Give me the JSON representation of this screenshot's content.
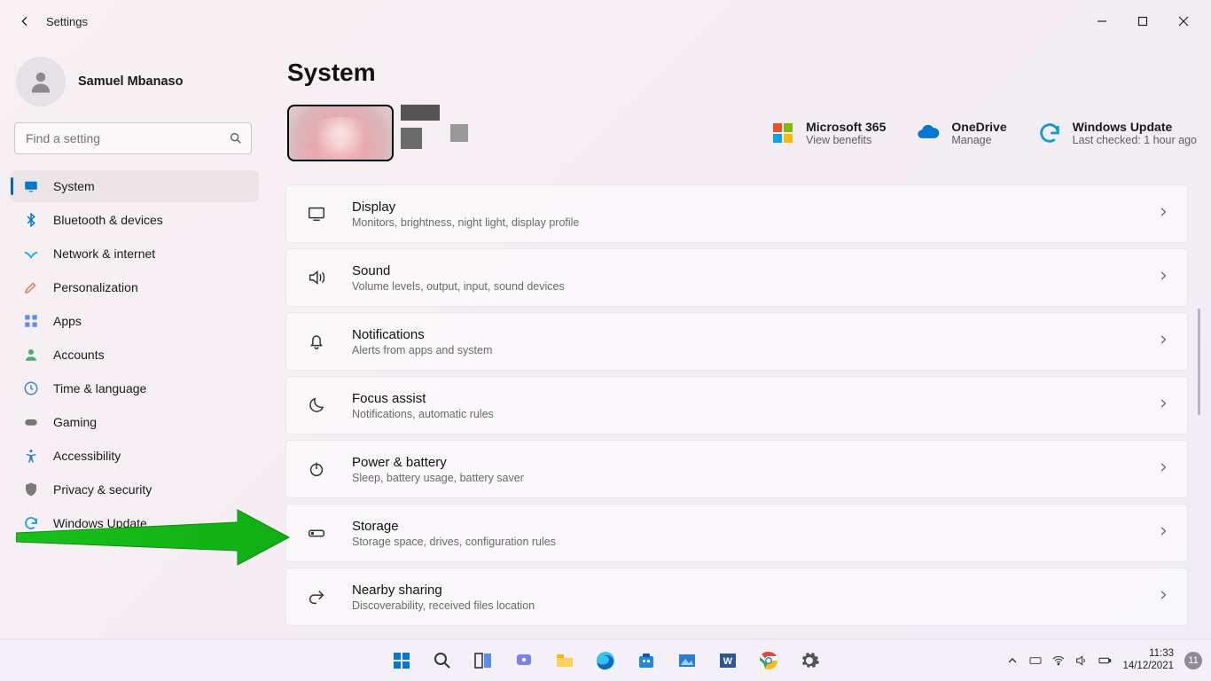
{
  "window": {
    "title": "Settings"
  },
  "user": {
    "name": "Samuel Mbanaso"
  },
  "search": {
    "placeholder": "Find a setting"
  },
  "sidebar": {
    "items": [
      {
        "label": "System"
      },
      {
        "label": "Bluetooth & devices"
      },
      {
        "label": "Network & internet"
      },
      {
        "label": "Personalization"
      },
      {
        "label": "Apps"
      },
      {
        "label": "Accounts"
      },
      {
        "label": "Time & language"
      },
      {
        "label": "Gaming"
      },
      {
        "label": "Accessibility"
      },
      {
        "label": "Privacy & security"
      },
      {
        "label": "Windows Update"
      }
    ]
  },
  "page": {
    "title": "System"
  },
  "header_cards": {
    "ms365": {
      "title": "Microsoft 365",
      "sub": "View benefits"
    },
    "onedrive": {
      "title": "OneDrive",
      "sub": "Manage"
    },
    "wu": {
      "title": "Windows Update",
      "sub": "Last checked: 1 hour ago"
    }
  },
  "settings": [
    {
      "title": "Display",
      "sub": "Monitors, brightness, night light, display profile"
    },
    {
      "title": "Sound",
      "sub": "Volume levels, output, input, sound devices"
    },
    {
      "title": "Notifications",
      "sub": "Alerts from apps and system"
    },
    {
      "title": "Focus assist",
      "sub": "Notifications, automatic rules"
    },
    {
      "title": "Power & battery",
      "sub": "Sleep, battery usage, battery saver"
    },
    {
      "title": "Storage",
      "sub": "Storage space, drives, configuration rules"
    },
    {
      "title": "Nearby sharing",
      "sub": "Discoverability, received files location"
    }
  ],
  "taskbar": {
    "time": "11:33",
    "date": "14/12/2021",
    "notif_count": "11"
  }
}
